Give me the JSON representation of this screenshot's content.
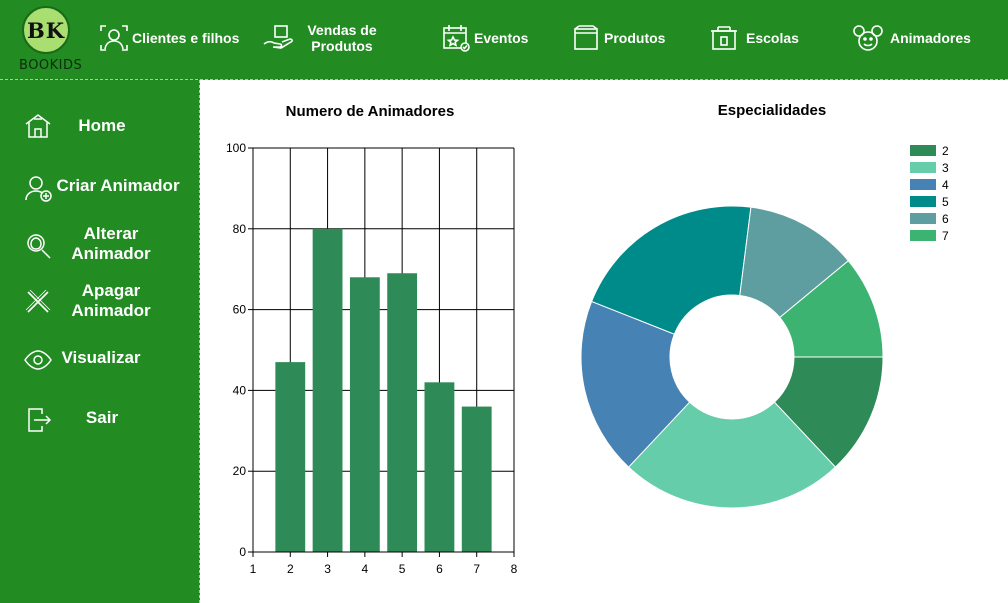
{
  "app": {
    "logo_initials": "BK",
    "logo_text": "BOOKIDS",
    "brand_color": "#228B22"
  },
  "nav": [
    {
      "label": "Clientes e filhos",
      "icon": "client-scan-icon"
    },
    {
      "label": "Vendas de Produtos",
      "icon": "hand-box-icon"
    },
    {
      "label": "Eventos",
      "icon": "calendar-icon"
    },
    {
      "label": "Produtos",
      "icon": "product-box-icon"
    },
    {
      "label": "Escolas",
      "icon": "school-icon"
    },
    {
      "label": "Animadores",
      "icon": "mickey-icon"
    }
  ],
  "sidebar": [
    {
      "label": "Home",
      "icon": "home-icon"
    },
    {
      "label": "Criar Animador",
      "icon": "add-user-icon"
    },
    {
      "label": "Alterar Animador",
      "icon": "search-user-icon"
    },
    {
      "label": "Apagar Animador",
      "icon": "close-x-icon"
    },
    {
      "label": "Visualizar",
      "icon": "eye-icon"
    },
    {
      "label": "Sair",
      "icon": "exit-door-icon"
    }
  ],
  "chart_data": [
    {
      "type": "bar",
      "title": "Numero de Animadores",
      "x": [
        2,
        3,
        4,
        5,
        6,
        7
      ],
      "values": [
        47,
        80,
        68,
        69,
        42,
        36
      ],
      "xlim": [
        1,
        8
      ],
      "ylim": [
        0,
        100
      ],
      "xticks": [
        1,
        2,
        3,
        4,
        5,
        6,
        7,
        8
      ],
      "yticks": [
        0,
        20,
        40,
        60,
        80,
        100
      ],
      "grid": true,
      "color": "#2E8B57"
    },
    {
      "type": "pie",
      "title": "Especialidades",
      "donut": true,
      "legend_position": "top-right",
      "labels": [
        "2",
        "3",
        "4",
        "5",
        "6",
        "7"
      ],
      "values": [
        13,
        24,
        19,
        21,
        12,
        11
      ],
      "colors": [
        "#2E8B57",
        "#66CDAA",
        "#4682B4",
        "#008B8B",
        "#5F9EA0",
        "#3CB371"
      ]
    }
  ]
}
